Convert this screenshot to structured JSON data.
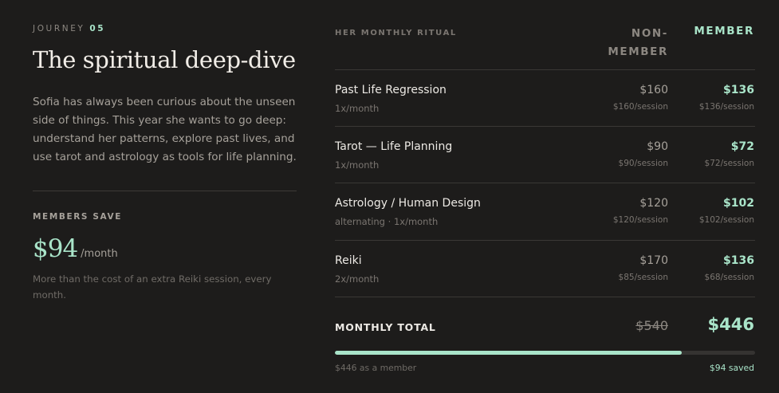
{
  "journey": {
    "eyebrow_label": "JOURNEY",
    "eyebrow_number": "05",
    "title": "The spiritual deep-dive",
    "intro": "Sofia has always been curious about the unseen side of things. This year she wants to go deep: understand her patterns, explore past lives, and use tarot and astrology as tools for life planning."
  },
  "savings": {
    "label": "MEMBERS SAVE",
    "amount": "$94",
    "per": "/month",
    "note": "More than the cost of an extra Reiki session, every month."
  },
  "table": {
    "ritual_header": "HER MONTHLY RITUAL",
    "non_member_header": "NON-MEMBER",
    "member_header": "MEMBER",
    "rows": [
      {
        "name": "Past Life Regression",
        "freq": "1x/month",
        "non_price": "$160",
        "non_per": "$160/session",
        "member_price": "$136",
        "member_per": "$136/session"
      },
      {
        "name": "Tarot — Life Planning",
        "freq": "1x/month",
        "non_price": "$90",
        "non_per": "$90/session",
        "member_price": "$72",
        "member_per": "$72/session"
      },
      {
        "name": "Astrology / Human Design",
        "freq": "alternating · 1x/month",
        "non_price": "$120",
        "non_per": "$120/session",
        "member_price": "$102",
        "member_per": "$102/session"
      },
      {
        "name": "Reiki",
        "freq": "2x/month",
        "non_price": "$170",
        "non_per": "$85/session",
        "member_price": "$136",
        "member_per": "$68/session"
      }
    ],
    "total_label": "MONTHLY TOTAL",
    "total_non_member": "$540",
    "total_member": "$446"
  },
  "progress": {
    "fraction": 0.826,
    "left_caption": "$446 as a member",
    "right_caption": "$94 saved"
  },
  "colors": {
    "accent": "#a9e4c9",
    "background": "#1d1c1b"
  }
}
